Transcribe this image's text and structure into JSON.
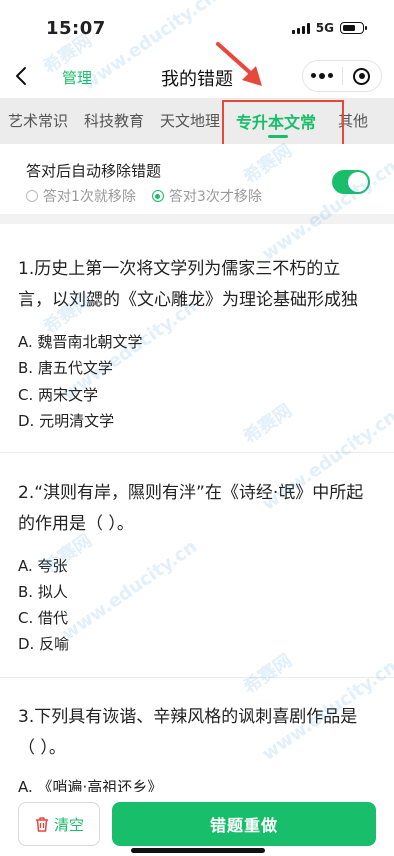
{
  "status": {
    "time": "15:07",
    "network": "5G"
  },
  "nav": {
    "manage": "管理",
    "title": "我的错题"
  },
  "tabs": [
    {
      "label": "艺术常识"
    },
    {
      "label": "科技教育"
    },
    {
      "label": "天文地理"
    },
    {
      "label": "专升本文常",
      "active": true
    },
    {
      "label": "其他"
    }
  ],
  "settings": {
    "title": "答对后自动移除错题",
    "option1": "答对1次就移除",
    "option2": "答对3次才移除",
    "selected_option": 2,
    "toggle_on": true
  },
  "questions": [
    {
      "stem": "1.历史上第一次将文学列为儒家三不朽的立言，以刘勰的《文心雕龙》为理论基础形成独",
      "options": [
        "A. 魏晋南北朝文学",
        "B. 唐五代文学",
        "C. 两宋文学",
        "D. 元明清文学"
      ]
    },
    {
      "stem": "2.“淇则有岸，隰则有泮”在《诗经·氓》中所起的作用是（ ）。",
      "options": [
        "A. 夸张",
        "B. 拟人",
        "C. 借代",
        "D. 反喻"
      ]
    },
    {
      "stem": "3.下列具有诙谐、辛辣风格的讽刺喜剧作品是（ ）。",
      "options": [
        "A. 《哨遍·高祖还乡》"
      ]
    }
  ],
  "bottom": {
    "clear": "清空",
    "redo": "错题重做"
  },
  "watermarks": [
    "希赛网",
    "www.educity.cn"
  ],
  "colors": {
    "accent": "#19be6b",
    "annotation": "#e8473c"
  }
}
